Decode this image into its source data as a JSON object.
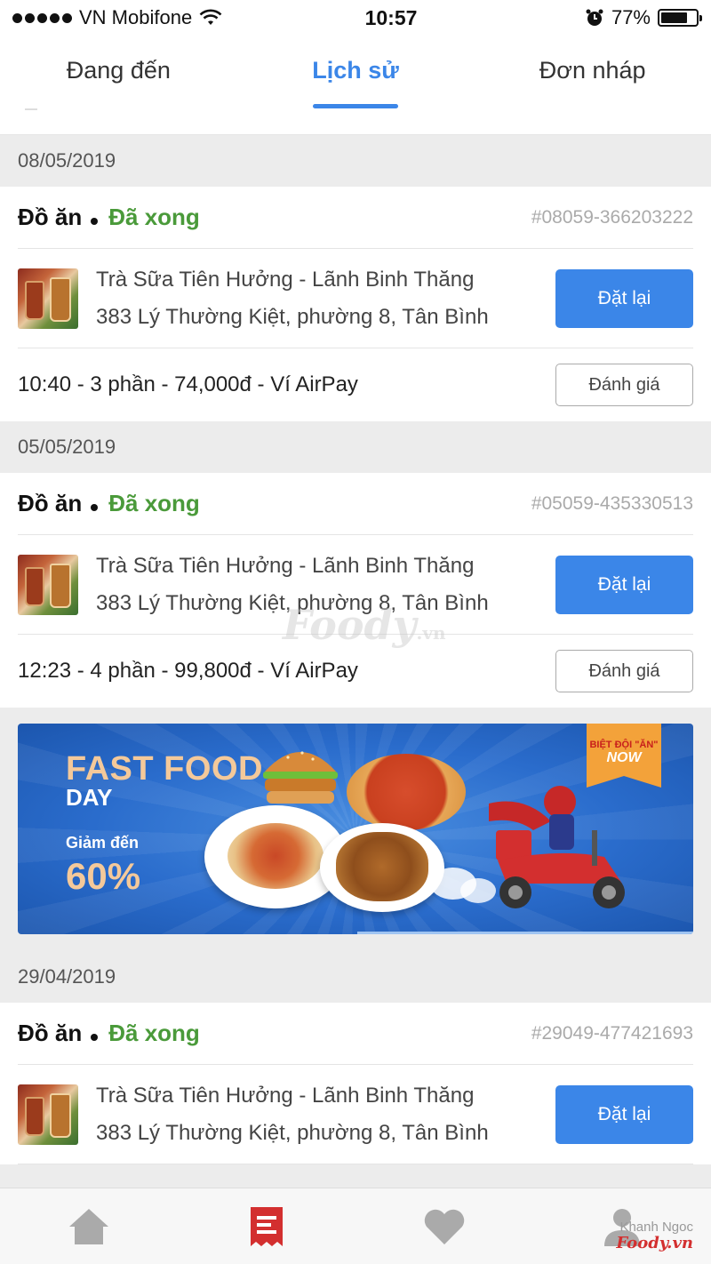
{
  "status_bar": {
    "carrier": "VN Mobifone",
    "time": "10:57",
    "battery_percent": "77%",
    "battery_level": 0.77
  },
  "tabs": [
    {
      "label": "Đang đến",
      "active": false
    },
    {
      "label": "Lịch sử",
      "active": true
    },
    {
      "label": "Đơn nháp",
      "active": false
    }
  ],
  "orders": [
    {
      "date": "08/05/2019",
      "type": "Đồ ăn",
      "status": "Đã xong",
      "id": "#08059-366203222",
      "shop_name": "Trà Sữa Tiên Hưởng - Lãnh Binh Thăng",
      "shop_address": "383 Lý Thường Kiệt, phường 8, Tân Bình",
      "reorder_label": "Đặt lại",
      "summary": "10:40 - 3 phần - 74,000đ - Ví AirPay",
      "rate_label": "Đánh giá"
    },
    {
      "date": "05/05/2019",
      "type": "Đồ ăn",
      "status": "Đã xong",
      "id": "#05059-435330513",
      "shop_name": "Trà Sữa Tiên Hưởng - Lãnh Binh Thăng",
      "shop_address": "383 Lý Thường Kiệt, phường 8, Tân Bình",
      "reorder_label": "Đặt lại",
      "summary": "12:23 - 4 phần - 99,800đ - Ví AirPay",
      "rate_label": "Đánh giá"
    },
    {
      "date": "29/04/2019",
      "type": "Đồ ăn",
      "status": "Đã xong",
      "id": "#29049-477421693",
      "shop_name": "Trà Sữa Tiên Hưởng - Lãnh Binh Thăng",
      "shop_address": "383 Lý Thường Kiệt, phường 8, Tân Bình",
      "reorder_label": "Đặt lại"
    }
  ],
  "banner": {
    "title_line1": "FAST FOOD",
    "title_line2": "DAY",
    "subtitle": "Giảm đến",
    "percent": "60%",
    "badge_line1": "BIỆT ĐỘI \"ĂN\"",
    "badge_line2": "NOW"
  },
  "watermark": {
    "text": "Foody",
    "suffix": ".vn"
  },
  "bottom_nav": {
    "items": [
      {
        "icon": "home-icon",
        "active": false
      },
      {
        "icon": "orders-icon",
        "active": true
      },
      {
        "icon": "heart-icon",
        "active": false
      },
      {
        "icon": "profile-icon",
        "active": false
      }
    ]
  },
  "corner_tag": {
    "author": "Khanh Ngoc",
    "brand": "Foody.vn"
  },
  "colors": {
    "accent": "#3b86e8",
    "status_done": "#4a9a3a",
    "orders_icon": "#d32f2f"
  }
}
